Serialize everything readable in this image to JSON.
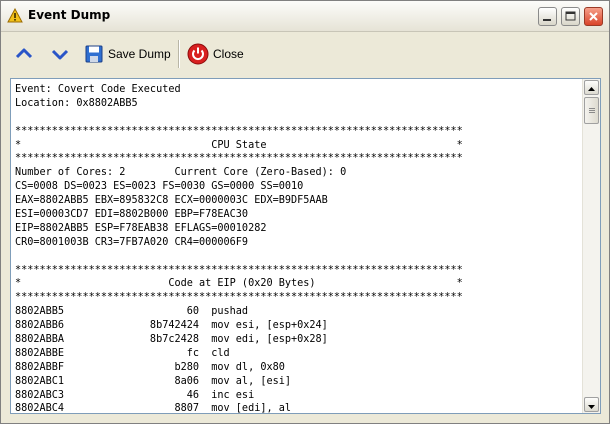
{
  "window": {
    "title": "Event Dump",
    "title_icon": "warning-icon"
  },
  "title_buttons": {
    "minimize": "minimize-icon",
    "maximize": "maximize-icon",
    "close": "close-icon"
  },
  "toolbar": {
    "up_icon": "chevron-up-icon",
    "down_icon": "chevron-down-icon",
    "save_label": "Save Dump",
    "save_icon": "floppy-disk-icon",
    "close_label": "Close",
    "close_icon": "power-icon"
  },
  "dump": {
    "lines": [
      "Event: Covert Code Executed",
      "Location: 0x8802ABB5",
      "",
      "*************************************************************************",
      "*                               CPU State                               *",
      "*************************************************************************",
      "Number of Cores: 2        Current Core (Zero-Based): 0",
      "CS=0008 DS=0023 ES=0023 FS=0030 GS=0000 SS=0010",
      "EAX=8802ABB5 EBX=895832C8 ECX=0000003C EDX=B9DF5AAB",
      "ESI=00003CD7 EDI=8802B000 EBP=F78EAC30",
      "EIP=8802ABB5 ESP=F78EAB38 EFLAGS=00010282",
      "CR0=8001003B CR3=7FB7A020 CR4=000006F9",
      "",
      "*************************************************************************",
      "*                        Code at EIP (0x20 Bytes)                       *",
      "*************************************************************************",
      "8802ABB5                    60  pushad",
      "8802ABB6              8b742424  mov esi, [esp+0x24]",
      "8802ABBA              8b7c2428  mov edi, [esp+0x28]",
      "8802ABBE                    fc  cld",
      "8802ABBF                  b280  mov dl, 0x80",
      "8802ABC1                  8a06  mov al, [esi]",
      "8802ABC3                    46  inc esi",
      "8802ABC4                  8807  mov [edi], al"
    ]
  }
}
